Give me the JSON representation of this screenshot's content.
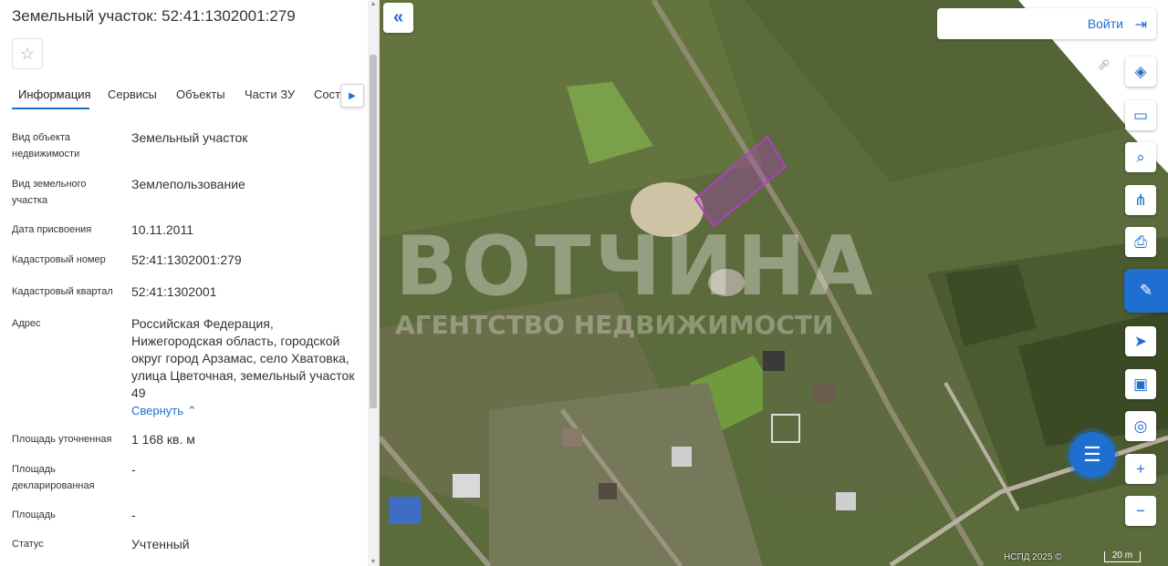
{
  "panel": {
    "title": "Земельный участок: 52:41:1302001:279",
    "tabs": [
      "Информация",
      "Сервисы",
      "Объекты",
      "Части ЗУ",
      "Соста"
    ],
    "rows": [
      {
        "label": "Вид объекта недвижимости",
        "value": "Земельный участок"
      },
      {
        "label": "Вид земельного участка",
        "value": "Землепользование"
      },
      {
        "label": "Дата присвоения",
        "value": "10.11.2011"
      },
      {
        "label": "Кадастровый номер",
        "value": "52:41:1302001:279"
      },
      {
        "label": "Кадастровый квартал",
        "value": "52:41:1302001"
      },
      {
        "label": "Адрес",
        "value": "Российская Федерация, Нижегородская область, городской округ город Арзамас, село Хватовка, улица Цветочная, земельный участок 49"
      },
      {
        "label": "Площадь уточненная",
        "value": "1 168 кв. м"
      },
      {
        "label": "Площадь декларированная",
        "value": "-"
      },
      {
        "label": "Площадь",
        "value": "-"
      },
      {
        "label": "Статус",
        "value": "Учтенный"
      }
    ],
    "collapse_label": "Свернуть"
  },
  "map": {
    "login_label": "Войти",
    "watermark_main": "ВОТЧИНА",
    "watermark_sub": "АГЕНТСТВО НЕДВИЖИМОСТИ",
    "attribution": "НСПД 2025 ©",
    "scale_label": "20 m"
  },
  "colors": {
    "accent": "#1f6fd0",
    "parcel": "#b040c0"
  }
}
